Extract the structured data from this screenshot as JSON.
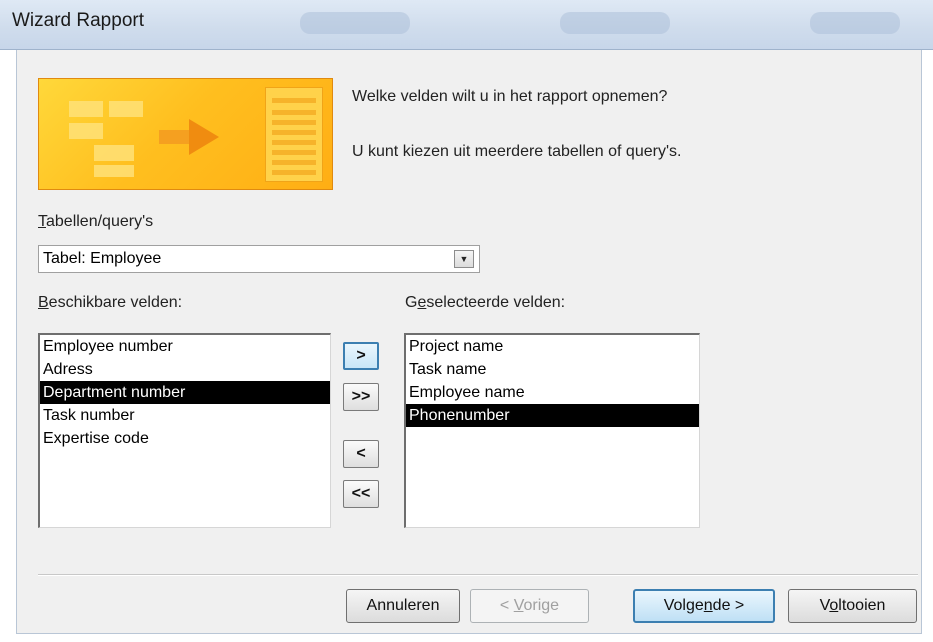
{
  "window": {
    "title": "Wizard Rapport"
  },
  "intro": {
    "question": "Welke velden wilt u in het rapport opnemen?",
    "hint": "U kunt kiezen uit meerdere tabellen of query's."
  },
  "source": {
    "label_prefix": "",
    "label_mnemonic": "T",
    "label_rest": "abellen/query's",
    "selected": "Tabel: Employee"
  },
  "available": {
    "label_mnemonic": "B",
    "label_rest": "eschikbare velden:",
    "items": [
      "Employee number",
      "Adress",
      "Department number",
      "Task number",
      "Expertise code"
    ],
    "selected_index": 2
  },
  "selected_fields": {
    "label_before": "G",
    "label_mnemonic": "e",
    "label_rest": "selecteerde velden:",
    "items": [
      "Project name",
      "Task name",
      "Employee name",
      "Phonenumber"
    ],
    "selected_index": 3
  },
  "move_buttons": {
    "add_one": ">",
    "add_all": ">>",
    "remove_one": "<",
    "remove_all": "<<"
  },
  "footer": {
    "cancel": "Annuleren",
    "back_prefix": "< ",
    "back_mnemonic": "V",
    "back_rest": "orige",
    "next_before": "Volge",
    "next_mnemonic": "n",
    "next_rest": "de >",
    "finish_before": "V",
    "finish_mnemonic": "o",
    "finish_rest": "ltooien"
  },
  "colors": {
    "accent": "#3c7fb1",
    "banner": "#ffbf1f",
    "selection": "#000000"
  }
}
